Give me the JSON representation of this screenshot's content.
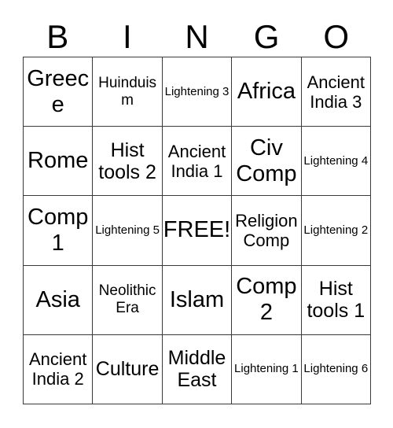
{
  "card": {
    "header_letters": [
      "B",
      "I",
      "N",
      "G",
      "O"
    ],
    "rows": [
      [
        {
          "label": "Greece",
          "size": "xl"
        },
        {
          "label": "Huinduism",
          "size": "sm"
        },
        {
          "label": "Lightening 3",
          "size": "xs"
        },
        {
          "label": "Africa",
          "size": "xl"
        },
        {
          "label": "Ancient India 3",
          "size": "md"
        }
      ],
      [
        {
          "label": "Rome",
          "size": "xl"
        },
        {
          "label": "Hist tools 2",
          "size": "lg"
        },
        {
          "label": "Ancient India 1",
          "size": "md"
        },
        {
          "label": "Civ Comp",
          "size": "xl"
        },
        {
          "label": "Lightening 4",
          "size": "xs"
        }
      ],
      [
        {
          "label": "Comp 1",
          "size": "xl"
        },
        {
          "label": "Lightening 5",
          "size": "xs"
        },
        {
          "label": "FREE!",
          "size": "xl"
        },
        {
          "label": "Religion Comp",
          "size": "md"
        },
        {
          "label": "Lightening 2",
          "size": "xs"
        }
      ],
      [
        {
          "label": "Asia",
          "size": "xl"
        },
        {
          "label": "Neolithic Era",
          "size": "sm"
        },
        {
          "label": "Islam",
          "size": "xl"
        },
        {
          "label": "Comp 2",
          "size": "xl"
        },
        {
          "label": "Hist tools 1",
          "size": "lg"
        }
      ],
      [
        {
          "label": "Ancient India 2",
          "size": "md"
        },
        {
          "label": "Culture",
          "size": "lg"
        },
        {
          "label": "Middle East",
          "size": "lg"
        },
        {
          "label": "Lightening 1",
          "size": "xs"
        },
        {
          "label": "Lightening 6",
          "size": "xs"
        }
      ]
    ]
  },
  "colors": {
    "background": "#ffffff",
    "text": "#000000",
    "grid_line": "#3a3a3a"
  }
}
